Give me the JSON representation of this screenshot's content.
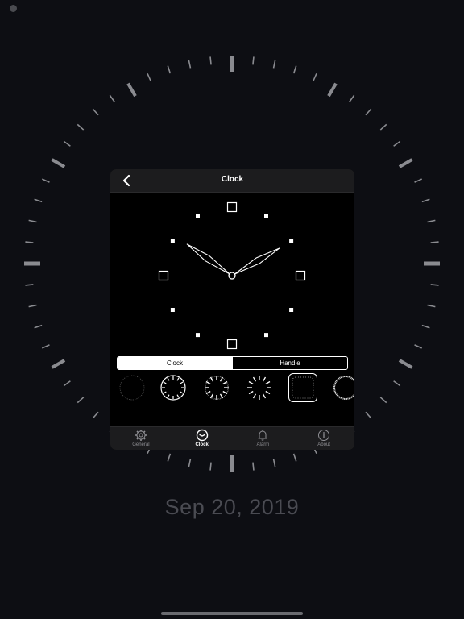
{
  "date": "Sep 20, 2019",
  "panel": {
    "title": "Clock"
  },
  "segmented_control": {
    "options": [
      "Clock",
      "Handle"
    ],
    "selected": "Clock"
  },
  "clock_styles": {
    "count_visible": 6,
    "selected_index": 4
  },
  "preview_time": {
    "hour": 10,
    "minute": 10
  },
  "tab_bar": {
    "items": [
      {
        "label": "General",
        "icon": "gear-icon"
      },
      {
        "label": "Clock",
        "icon": "clock-icon"
      },
      {
        "label": "Alarm",
        "icon": "bell-icon"
      },
      {
        "label": "About",
        "icon": "info-icon"
      }
    ],
    "active": "Clock"
  },
  "colors": {
    "background": "#0d0e13",
    "panel": "#000000",
    "bars": "#1c1c1e",
    "tick": "#8a8b90",
    "accent": "#ffffff",
    "inactive_tab": "#8e8e93",
    "date_text": "#4a4b52"
  }
}
